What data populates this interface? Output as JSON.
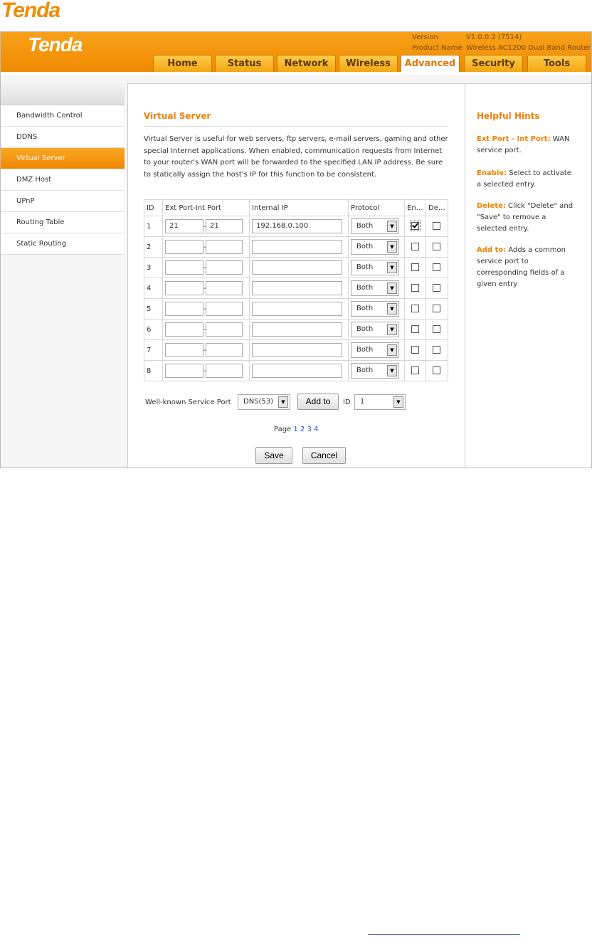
{
  "doc_logo": "Tenda",
  "header": {
    "logo": "Tenda",
    "version_label": "Version",
    "version_value": "V1.0.0.2 (7514)",
    "product_label": "Product Name",
    "product_value": "Wireless AC1200 Dual Band Router"
  },
  "tabs": [
    "Home",
    "Status",
    "Network",
    "Wireless",
    "Advanced",
    "Security",
    "Tools"
  ],
  "sidebar": [
    "Bandwidth Control",
    "DDNS",
    "Virtual Server",
    "DMZ Host",
    "UPnP",
    "Routing Table",
    "Static Routing"
  ],
  "section": {
    "title": "Virtual Server",
    "description": "Virtual Server is useful for web servers, ftp servers, e-mail servers, gaming and other special Internet applications. When enabled, communication requests from Internet to your router's WAN port will be forwarded to the specified LAN IP address. Be sure to statically assign the host's IP for this function to be consistent."
  },
  "table": {
    "headers": [
      "ID",
      "Ext Port-Int Port",
      "Internal IP",
      "Protocol",
      "En…",
      "De…"
    ],
    "rows": [
      {
        "id": "1",
        "ext": "21",
        "int": "21",
        "ip": "192.168.0.100",
        "protocol": "Both",
        "enable": true
      },
      {
        "id": "2",
        "ext": "",
        "int": "",
        "ip": "",
        "protocol": "Both",
        "enable": false
      },
      {
        "id": "3",
        "ext": "",
        "int": "",
        "ip": "",
        "protocol": "Both",
        "enable": false
      },
      {
        "id": "4",
        "ext": "",
        "int": "",
        "ip": "",
        "protocol": "Both",
        "enable": false
      },
      {
        "id": "5",
        "ext": "",
        "int": "",
        "ip": "",
        "protocol": "Both",
        "enable": false
      },
      {
        "id": "6",
        "ext": "",
        "int": "",
        "ip": "",
        "protocol": "Both",
        "enable": false
      },
      {
        "id": "7",
        "ext": "",
        "int": "",
        "ip": "",
        "protocol": "Both",
        "enable": false
      },
      {
        "id": "8",
        "ext": "",
        "int": "",
        "ip": "",
        "protocol": "Both",
        "enable": false
      }
    ]
  },
  "wellknown": {
    "label": "Well-known Service Port",
    "service": "DNS(53)",
    "add_to": "Add to",
    "id_label": "ID",
    "id_value": "1"
  },
  "pagination": {
    "label": "Page",
    "pages": [
      "1",
      "2",
      "3",
      "4"
    ]
  },
  "buttons": {
    "save": "Save",
    "cancel": "Cancel"
  },
  "hints": {
    "title": "Helpful Hints",
    "items": [
      {
        "term": "Ext Port - Int Port:",
        "text": " WAN service port."
      },
      {
        "term": "Enable:",
        "text": " Select to activate a selected entry."
      },
      {
        "term": "Delete:",
        "text": " Click \"Delete\" and \"Save\" to remove a selected entry."
      },
      {
        "term": "Add to:",
        "text": " Adds a common service port to corresponding fields of a given entry"
      }
    ]
  }
}
